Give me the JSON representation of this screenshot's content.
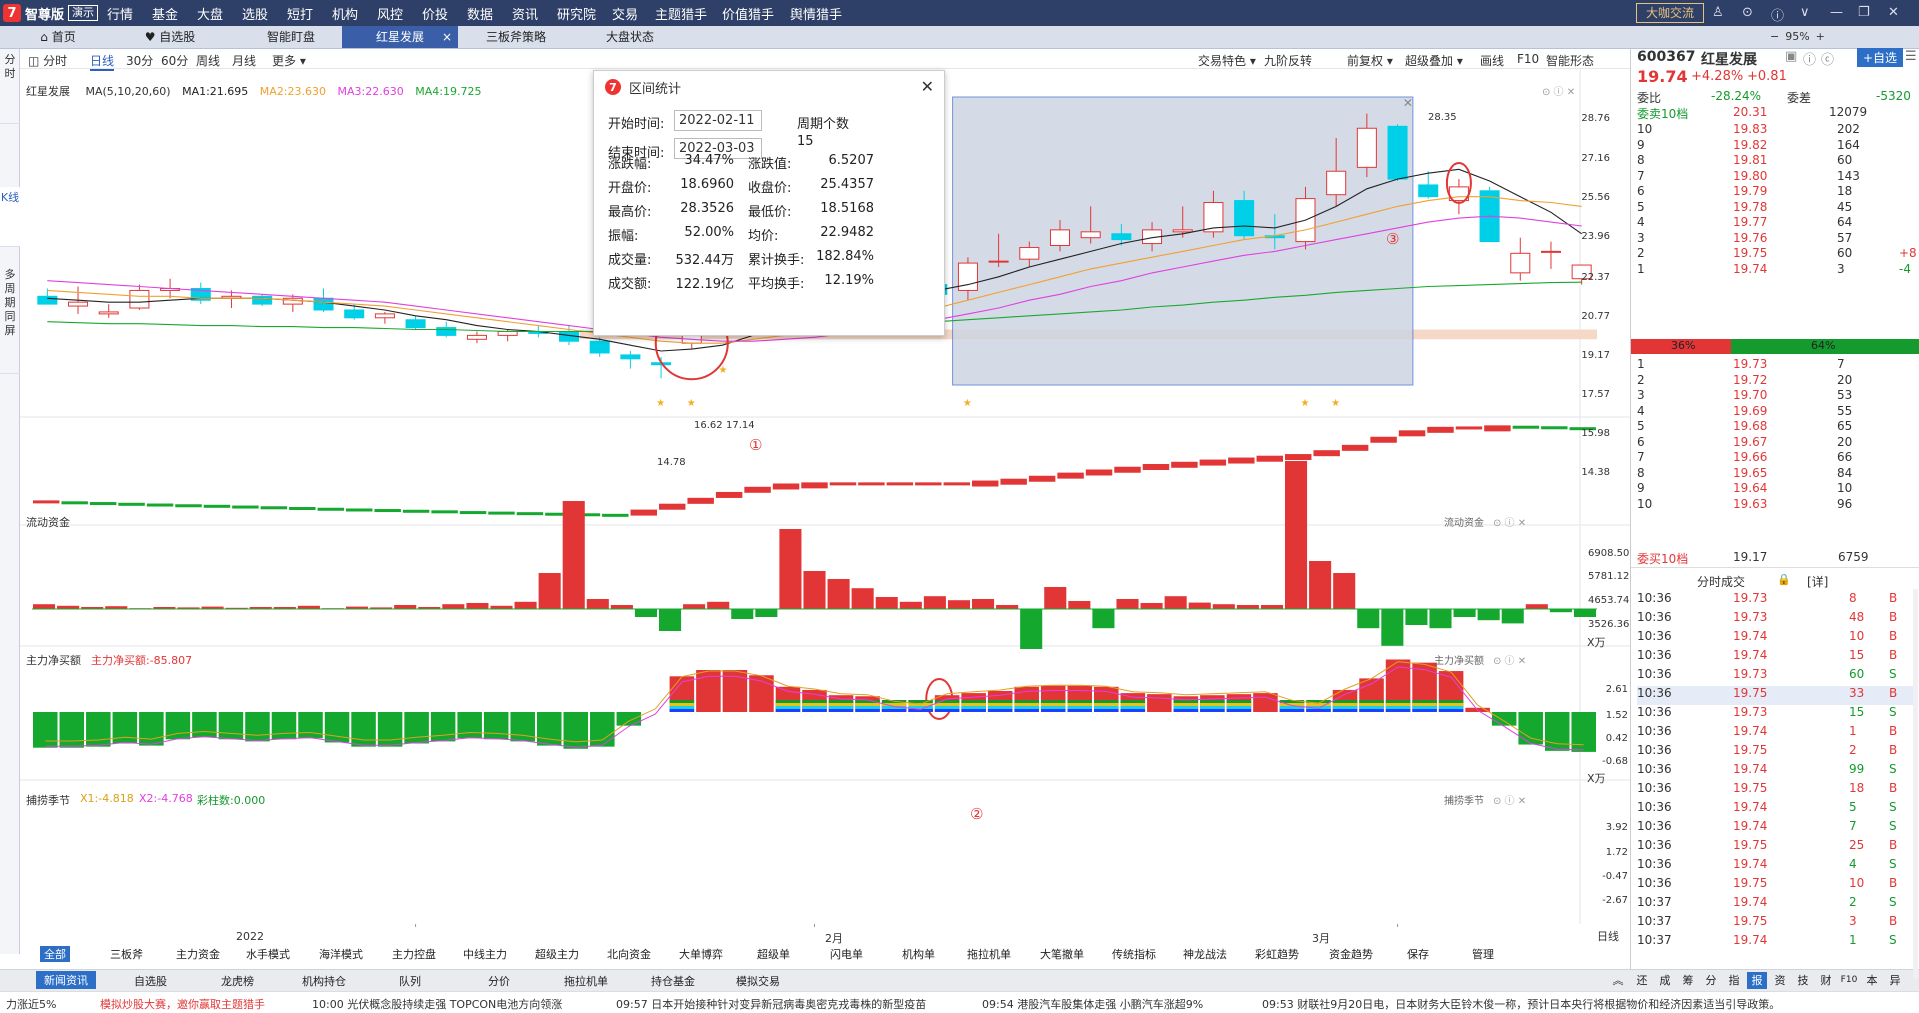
{
  "app": {
    "logo_text": "智尊版",
    "edition": "演示",
    "dakajiaoliu": "大咖交流",
    "zoom": "95%"
  },
  "menu": [
    "行情",
    "基金",
    "大盘",
    "选股",
    "短打",
    "机构",
    "风控",
    "价投",
    "数据",
    "资讯",
    "研究院",
    "交易",
    "主题猎手",
    "价值猎手",
    "舆情猎手"
  ],
  "tabs": [
    {
      "label": "首页"
    },
    {
      "label": "自选股"
    },
    {
      "label": "智能盯盘"
    },
    {
      "label": "红星发展",
      "close": "×"
    },
    {
      "label": "三板斧策略"
    },
    {
      "label": "大盘状态"
    }
  ],
  "left_tabs": [
    "分时",
    "K线",
    "多周期同屏"
  ],
  "periods": [
    "分时",
    "日线",
    "30分",
    "60分",
    "周线",
    "月线",
    "更多 ▾"
  ],
  "chart_tools": [
    "交易特色 ▾",
    "九阶反转",
    "前复权 ▾",
    "超级叠加 ▾",
    "画线",
    "F10",
    "智能形态"
  ],
  "legend": {
    "name": "红星发展",
    "ma_name": "MA(5,10,20,60)",
    "ma1": "MA1:21.695",
    "ma2": "MA2:23.630",
    "ma3": "MA3:22.630",
    "ma4": "MA4:19.725"
  },
  "colors": {
    "up": "#e23636",
    "down": "#00cfe8",
    "ma1": "#222222",
    "ma2": "#f0a030",
    "ma3": "#e040e0",
    "ma4": "#1aa830",
    "greenbar": "#14a82f",
    "select": "#9fb0cc"
  },
  "price_axis": [
    "28.76",
    "27.16",
    "25.56",
    "23.96",
    "22.37",
    "20.77",
    "19.17",
    "17.57",
    "15.98",
    "14.38"
  ],
  "price_annotations": {
    "high": "28.35",
    "low": "14.78",
    "mid": "16.62",
    "mid2": "17.14"
  },
  "circle_labels": [
    "①",
    "②",
    "③"
  ],
  "x_axis": [
    "2022",
    "2月",
    "3月"
  ],
  "x_axis_right": "日线",
  "panels": {
    "p2": {
      "title": "流动资金",
      "right": "流动资金",
      "yaxis": [
        "6908.50",
        "5781.12",
        "4653.74",
        "3526.36"
      ],
      "unit": "X万"
    },
    "p3": {
      "title": "主力净买额",
      "value": "主力净买额:-85.807",
      "right": "主力净买额",
      "yaxis": [
        "2.61",
        "1.52",
        "0.42",
        "-0.68"
      ],
      "unit": "X万"
    },
    "p4": {
      "title": "捕捞季节",
      "x1": "X1:-4.818",
      "x2": "X2:-4.768",
      "cz": "彩柱数:0.000",
      "right": "捕捞季节",
      "yaxis": [
        "3.92",
        "1.72",
        "-0.47",
        "-2.67"
      ]
    }
  },
  "dialog": {
    "title": "区间统计",
    "start_label": "开始时间:",
    "start": "2022-02-11",
    "end_label": "结束时间:",
    "end": "2022-03-03",
    "period_label": "周期个数",
    "period": "15",
    "rows": [
      [
        "涨跌幅:",
        "34.47%",
        "涨跌值:",
        "6.5207"
      ],
      [
        "开盘价:",
        "18.6960",
        "收盘价:",
        "25.4357"
      ],
      [
        "最高价:",
        "28.3526",
        "最低价:",
        "18.5168"
      ],
      [
        "振幅:",
        "52.00%",
        "均价:",
        "22.9482"
      ],
      [
        "成交量:",
        "532.44万",
        "累计换手:",
        "182.84%"
      ],
      [
        "成交额:",
        "122.19亿",
        "平均换手:",
        "12.19%"
      ]
    ]
  },
  "bottom_nav": [
    "全部",
    "三板斧",
    "主力资金",
    "水手模式",
    "海洋模式",
    "主力控盘",
    "中线主力",
    "超级主力",
    "北向资金",
    "大单博弈",
    "超级单",
    "闪电单",
    "机构单",
    "拖拉机单",
    "大笔撤单",
    "传统指标",
    "神龙战法",
    "彩虹趋势",
    "资金趋势",
    "保存",
    "管理"
  ],
  "news_tabs": [
    "新闻资讯",
    "自选股",
    "龙虎榜",
    "机构持仓",
    "队列",
    "分价",
    "拖拉机单",
    "持仓基金",
    "模拟交易"
  ],
  "news_right": [
    "还",
    "成",
    "筹",
    "分",
    "指",
    "报",
    "资",
    "技",
    "财",
    "F10",
    "本",
    "异"
  ],
  "ticker": [
    {
      "t": "力涨近5%",
      "c": "#222"
    },
    {
      "t": "模拟炒股大赛，邀你赢取主题猎手",
      "c": "#e23636"
    },
    {
      "t": "10:00 光伏概念股持续走强 TOPCON电池方向领涨",
      "c": "#222"
    },
    {
      "t": "09:57 日本开始接种针对变异新冠病毒奥密克戎毒株的新型疫苗",
      "c": "#222"
    },
    {
      "t": "09:54 港股汽车股集体走强 小鹏汽车涨超9%",
      "c": "#222"
    },
    {
      "t": "09:53 财联社9月20日电，日本财务大臣铃木俊一称，预计日本央行将根据物价和经济因素适当引导政策。",
      "c": "#222"
    }
  ],
  "quote": {
    "code": "600367",
    "name": "红星发展",
    "price": "19.74",
    "pct": "+4.28%",
    "chg": "+0.81",
    "add_btn": "+自选",
    "weibi_label": "委比",
    "weibi": "-28.24%",
    "weicha_label": "委差",
    "weicha": "-5320",
    "sell_label": "委卖10档",
    "sell_val": "20.31",
    "sell_vol": "12079",
    "buy_label": "委买10档",
    "buy_val": "19.17",
    "buy_vol": "6759",
    "ratio_l": "36%",
    "ratio_r": "64%"
  },
  "sells": [
    [
      "10",
      "19.83",
      "202"
    ],
    [
      "9",
      "19.82",
      "164"
    ],
    [
      "8",
      "19.81",
      "60"
    ],
    [
      "7",
      "19.80",
      "143"
    ],
    [
      "6",
      "19.79",
      "18"
    ],
    [
      "5",
      "19.78",
      "45"
    ],
    [
      "4",
      "19.77",
      "64"
    ],
    [
      "3",
      "19.76",
      "57"
    ],
    [
      "2",
      "19.75",
      "60",
      "+8"
    ],
    [
      "1",
      "19.74",
      "3",
      "-4"
    ]
  ],
  "buys": [
    [
      "1",
      "19.73",
      "7"
    ],
    [
      "2",
      "19.72",
      "20"
    ],
    [
      "3",
      "19.70",
      "53"
    ],
    [
      "4",
      "19.69",
      "55"
    ],
    [
      "5",
      "19.68",
      "65"
    ],
    [
      "6",
      "19.67",
      "20"
    ],
    [
      "7",
      "19.66",
      "66"
    ],
    [
      "8",
      "19.65",
      "84"
    ],
    [
      "9",
      "19.64",
      "10"
    ],
    [
      "10",
      "19.63",
      "96"
    ]
  ],
  "trades_title": "分时成交",
  "trades_detail": "[详]",
  "trades": [
    [
      "10:36",
      "19.73",
      "8",
      "B"
    ],
    [
      "10:36",
      "19.73",
      "48",
      "B"
    ],
    [
      "10:36",
      "19.74",
      "10",
      "B"
    ],
    [
      "10:36",
      "19.74",
      "15",
      "B"
    ],
    [
      "10:36",
      "19.73",
      "60",
      "S"
    ],
    [
      "10:36",
      "19.75",
      "33",
      "B"
    ],
    [
      "10:36",
      "19.73",
      "15",
      "S"
    ],
    [
      "10:36",
      "19.74",
      "1",
      "B"
    ],
    [
      "10:36",
      "19.75",
      "2",
      "B"
    ],
    [
      "10:36",
      "19.74",
      "99",
      "S"
    ],
    [
      "10:36",
      "19.75",
      "18",
      "B"
    ],
    [
      "10:36",
      "19.74",
      "5",
      "S"
    ],
    [
      "10:36",
      "19.74",
      "7",
      "S"
    ],
    [
      "10:36",
      "19.75",
      "25",
      "B"
    ],
    [
      "10:36",
      "19.74",
      "4",
      "S"
    ],
    [
      "10:36",
      "19.75",
      "10",
      "B"
    ],
    [
      "10:37",
      "19.74",
      "2",
      "S"
    ],
    [
      "10:37",
      "19.75",
      "3",
      "B"
    ],
    [
      "10:37",
      "19.74",
      "1",
      "S"
    ]
  ],
  "chart_data": {
    "type": "candlestick",
    "title": "红星发展",
    "candles": [
      [
        19.0,
        19.4,
        18.8,
        18.6
      ],
      [
        18.5,
        19.5,
        18.1,
        18.7
      ],
      [
        18.1,
        18.6,
        17.9,
        18.2
      ],
      [
        18.4,
        19.6,
        18.3,
        19.3
      ],
      [
        19.3,
        19.9,
        18.9,
        19.4
      ],
      [
        19.4,
        19.7,
        18.6,
        18.8
      ],
      [
        18.9,
        19.3,
        18.4,
        19.0
      ],
      [
        19.0,
        19.1,
        18.5,
        18.6
      ],
      [
        18.6,
        19.1,
        18.2,
        18.9
      ],
      [
        18.9,
        19.4,
        18.2,
        18.3
      ],
      [
        18.3,
        18.6,
        17.8,
        17.9
      ],
      [
        17.9,
        18.2,
        17.6,
        18.1
      ],
      [
        17.8,
        18.0,
        17.3,
        17.4
      ],
      [
        17.4,
        17.7,
        16.9,
        17.0
      ],
      [
        16.8,
        17.2,
        16.6,
        17.0
      ],
      [
        17.0,
        17.3,
        16.7,
        17.2
      ],
      [
        17.2,
        17.5,
        16.9,
        17.1
      ],
      [
        17.2,
        17.5,
        16.5,
        16.7
      ],
      [
        16.7,
        16.9,
        15.9,
        16.1
      ],
      [
        16.0,
        16.2,
        15.3,
        15.8
      ],
      [
        15.6,
        15.9,
        14.8,
        15.5
      ],
      [
        16.6,
        17.7,
        16.3,
        17.1
      ],
      [
        17.6,
        18.6,
        17.0,
        17.8
      ],
      [
        18.0,
        19.6,
        17.4,
        18.7
      ],
      [
        18.6,
        19.4,
        18.1,
        19.0
      ],
      [
        18.7,
        20.1,
        17.6,
        19.9
      ],
      [
        19.6,
        20.3,
        19.2,
        19.4
      ],
      [
        19.3,
        19.6,
        18.8,
        19.1
      ],
      [
        19.0,
        19.8,
        18.8,
        19.6
      ],
      [
        19.6,
        19.9,
        19.0,
        19.1
      ],
      [
        19.3,
        21.0,
        18.8,
        20.7
      ],
      [
        20.8,
        22.2,
        20.5,
        20.8
      ],
      [
        20.9,
        21.8,
        20.5,
        21.5
      ],
      [
        21.6,
        22.9,
        21.3,
        22.4
      ],
      [
        22.0,
        23.6,
        21.7,
        22.3
      ],
      [
        22.2,
        22.7,
        21.6,
        21.9
      ],
      [
        21.7,
        22.8,
        21.3,
        22.4
      ],
      [
        22.3,
        23.6,
        22.0,
        22.4
      ],
      [
        22.3,
        24.4,
        22.0,
        23.8
      ],
      [
        23.9,
        24.4,
        21.9,
        22.1
      ],
      [
        22.1,
        23.2,
        21.4,
        22.0
      ],
      [
        21.8,
        24.6,
        21.4,
        24.0
      ],
      [
        24.2,
        27.1,
        23.6,
        25.4
      ],
      [
        25.6,
        28.35,
        25.1,
        27.6
      ],
      [
        27.7,
        27.8,
        24.9,
        25.0
      ],
      [
        24.7,
        25.4,
        24.0,
        24.1
      ],
      [
        23.9,
        25.0,
        23.2,
        24.6
      ],
      [
        24.4,
        24.6,
        21.8,
        21.8
      ],
      [
        20.2,
        22.0,
        19.8,
        21.2
      ],
      [
        21.3,
        21.8,
        20.4,
        21.3
      ],
      [
        19.9,
        20.6,
        19.6,
        20.6
      ]
    ],
    "ma_series": {
      "MA1": [
        18.9,
        18.8,
        18.7,
        18.7,
        18.8,
        18.9,
        18.9,
        18.9,
        18.8,
        18.7,
        18.5,
        18.3,
        18.0,
        17.8,
        17.5,
        17.3,
        17.2,
        17.0,
        16.8,
        16.5,
        16.2,
        16.3,
        16.5,
        17.0,
        17.6,
        18.2,
        18.7,
        19.0,
        19.2,
        19.3,
        19.6,
        20.0,
        20.5,
        20.9,
        21.3,
        21.7,
        22.0,
        22.2,
        22.5,
        22.6,
        22.5,
        22.9,
        23.6,
        24.5,
        25.0,
        25.3,
        25.5,
        24.9,
        24.1,
        23.3,
        22.2
      ],
      "MA2": [
        19.3,
        19.2,
        19.1,
        19.0,
        19.0,
        18.9,
        18.9,
        18.9,
        18.8,
        18.7,
        18.6,
        18.5,
        18.3,
        18.1,
        17.9,
        17.7,
        17.5,
        17.3,
        17.1,
        16.9,
        16.7,
        16.6,
        16.6,
        16.8,
        17.0,
        17.3,
        17.6,
        17.8,
        18.1,
        18.4,
        18.8,
        19.2,
        19.6,
        20.0,
        20.4,
        20.7,
        21.0,
        21.3,
        21.6,
        21.9,
        22.1,
        22.4,
        22.8,
        23.2,
        23.6,
        23.9,
        24.1,
        24.1,
        23.9,
        23.8,
        23.6
      ],
      "MA3": [
        19.8,
        19.7,
        19.6,
        19.5,
        19.4,
        19.3,
        19.2,
        19.1,
        19.0,
        18.9,
        18.8,
        18.7,
        18.5,
        18.3,
        18.1,
        17.9,
        17.7,
        17.5,
        17.3,
        17.1,
        16.9,
        16.8,
        16.7,
        16.7,
        16.8,
        16.9,
        17.1,
        17.3,
        17.5,
        17.8,
        18.1,
        18.4,
        18.8,
        19.1,
        19.5,
        19.8,
        20.2,
        20.5,
        20.8,
        21.1,
        21.3,
        21.6,
        21.9,
        22.2,
        22.5,
        22.8,
        23.0,
        23.1,
        23.0,
        22.8,
        22.6
      ],
      "MA4": [
        17.7,
        17.65,
        17.6,
        17.6,
        17.55,
        17.5,
        17.5,
        17.45,
        17.45,
        17.4,
        17.4,
        17.35,
        17.3,
        17.3,
        17.25,
        17.2,
        17.2,
        17.2,
        17.2,
        17.2,
        17.15,
        17.2,
        17.25,
        17.3,
        17.35,
        17.4,
        17.5,
        17.6,
        17.65,
        17.7,
        17.8,
        17.9,
        18.0,
        18.1,
        18.2,
        18.3,
        18.45,
        18.55,
        18.7,
        18.8,
        18.95,
        19.05,
        19.2,
        19.3,
        19.4,
        19.5,
        19.55,
        19.6,
        19.65,
        19.7,
        19.72
      ]
    },
    "ylim": [
      14.0,
      29.2
    ],
    "select_range": [
      30,
      44
    ],
    "circles": [
      [
        21,
        16.6,
        "①"
      ],
      [
        46,
        24.8,
        "③"
      ]
    ],
    "flow": [
      2620,
      2570,
      2530,
      2490,
      2450,
      2410,
      2380,
      2340,
      2300,
      2260,
      2220,
      2180,
      2150,
      2110,
      2080,
      2040,
      2010,
      1980,
      1950,
      1920,
      1890,
      2120,
      2440,
      2760,
      3080,
      3360,
      3540,
      3600,
      3600,
      3600,
      3600,
      3600,
      3600,
      3700,
      3800,
      3960,
      4130,
      4300,
      4450,
      4600,
      4720,
      4840,
      4950,
      5050,
      5140,
      5350,
      5640,
      6080,
      6430,
      6620,
      6640,
      6700,
      6680,
      6650,
      6600
    ],
    "flow_ylim": [
      1500,
      7100
    ],
    "net": [
      0.12,
      0.08,
      0.05,
      0.07,
      0.02,
      0.05,
      0.04,
      0.06,
      0.03,
      0.05,
      0.05,
      0.08,
      0.02,
      0.06,
      0.04,
      0.1,
      0.05,
      0.12,
      0.15,
      0.08,
      0.18,
      0.9,
      2.7,
      0.25,
      0.1,
      -0.2,
      -0.55,
      0.12,
      0.18,
      -0.25,
      -0.2,
      2.0,
      0.95,
      0.75,
      0.52,
      0.3,
      0.18,
      0.32,
      0.22,
      0.25,
      0.1,
      -1.0,
      0.55,
      0.2,
      -0.48,
      0.25,
      0.15,
      0.32,
      0.16,
      0.12,
      0.1,
      0.1,
      3.7,
      1.2,
      0.9,
      -0.48,
      -0.92,
      -0.4,
      -0.48,
      -0.2,
      -0.28,
      -0.36,
      0.12,
      -0.08,
      -0.2
    ],
    "net_ylim": [
      -1.5,
      4.2
    ],
    "season": [
      -3.4,
      -3.4,
      -3.3,
      -3.0,
      -3.2,
      -2.6,
      -2.4,
      -2.6,
      -2.8,
      -2.6,
      -2.5,
      -2.9,
      -3.3,
      -3.3,
      -3.0,
      -2.8,
      -2.5,
      -2.6,
      -2.8,
      -3.2,
      -3.5,
      -3.3,
      -1.3,
      0.0,
      3.4,
      4.0,
      4.0,
      3.5,
      2.4,
      2.1,
      1.6,
      1.5,
      0.8,
      0.5,
      1.6,
      1.8,
      2.0,
      2.4,
      2.5,
      2.5,
      2.4,
      1.8,
      1.7,
      1.5,
      1.6,
      1.7,
      1.8,
      0.9,
      0.6,
      2.1,
      3.2,
      5.0,
      4.7,
      3.9,
      0.4,
      -1.3,
      -3.1,
      -3.7,
      -3.8
    ],
    "season_stripes": [
      24,
      28,
      29,
      30,
      31,
      32,
      33,
      34,
      35,
      36,
      37,
      38,
      39,
      40,
      41,
      43,
      44,
      45,
      47,
      48,
      49,
      50,
      51,
      52,
      53
    ],
    "season_ylim": [
      -4.3,
      5.6
    ]
  }
}
